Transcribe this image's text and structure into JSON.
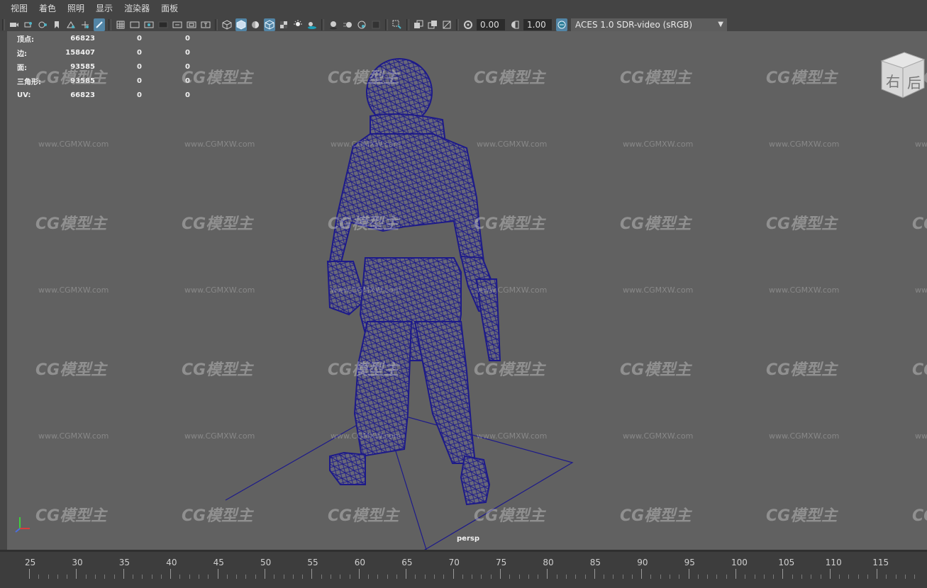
{
  "menu": {
    "items": [
      {
        "label": "视图"
      },
      {
        "label": "着色"
      },
      {
        "label": "照明"
      },
      {
        "label": "显示"
      },
      {
        "label": "渲染器"
      },
      {
        "label": "面板"
      }
    ]
  },
  "toolbar": {
    "exposure_value": "0.00",
    "gamma_value": "1.00",
    "color_space": "ACES 1.0 SDR-video (sRGB)"
  },
  "hud": {
    "rows": [
      {
        "label": "顶点:",
        "v1": "66823",
        "v2": "0",
        "v3": "0"
      },
      {
        "label": "边:",
        "v1": "158407",
        "v2": "0",
        "v3": "0"
      },
      {
        "label": "面:",
        "v1": "93585",
        "v2": "0",
        "v3": "0"
      },
      {
        "label": "三角形:",
        "v1": "93585",
        "v2": "0",
        "v3": "0"
      },
      {
        "label": "UV:",
        "v1": "66823",
        "v2": "0",
        "v3": "0"
      }
    ]
  },
  "viewcube": {
    "right_label": "右",
    "back_label": "后"
  },
  "camera_label": "persp",
  "watermark": {
    "logo": "CG模型主",
    "url": "www.CGMXW.com"
  },
  "timeline": {
    "labels": [
      "25",
      "30",
      "35",
      "40",
      "45",
      "50",
      "55",
      "60",
      "65",
      "70",
      "75",
      "80",
      "85",
      "90",
      "95",
      "100",
      "105",
      "110",
      "115"
    ]
  },
  "colors": {
    "viewport_bg": "#616161",
    "wireframe": "#1d1a8a",
    "active_button": "#5285a6"
  }
}
